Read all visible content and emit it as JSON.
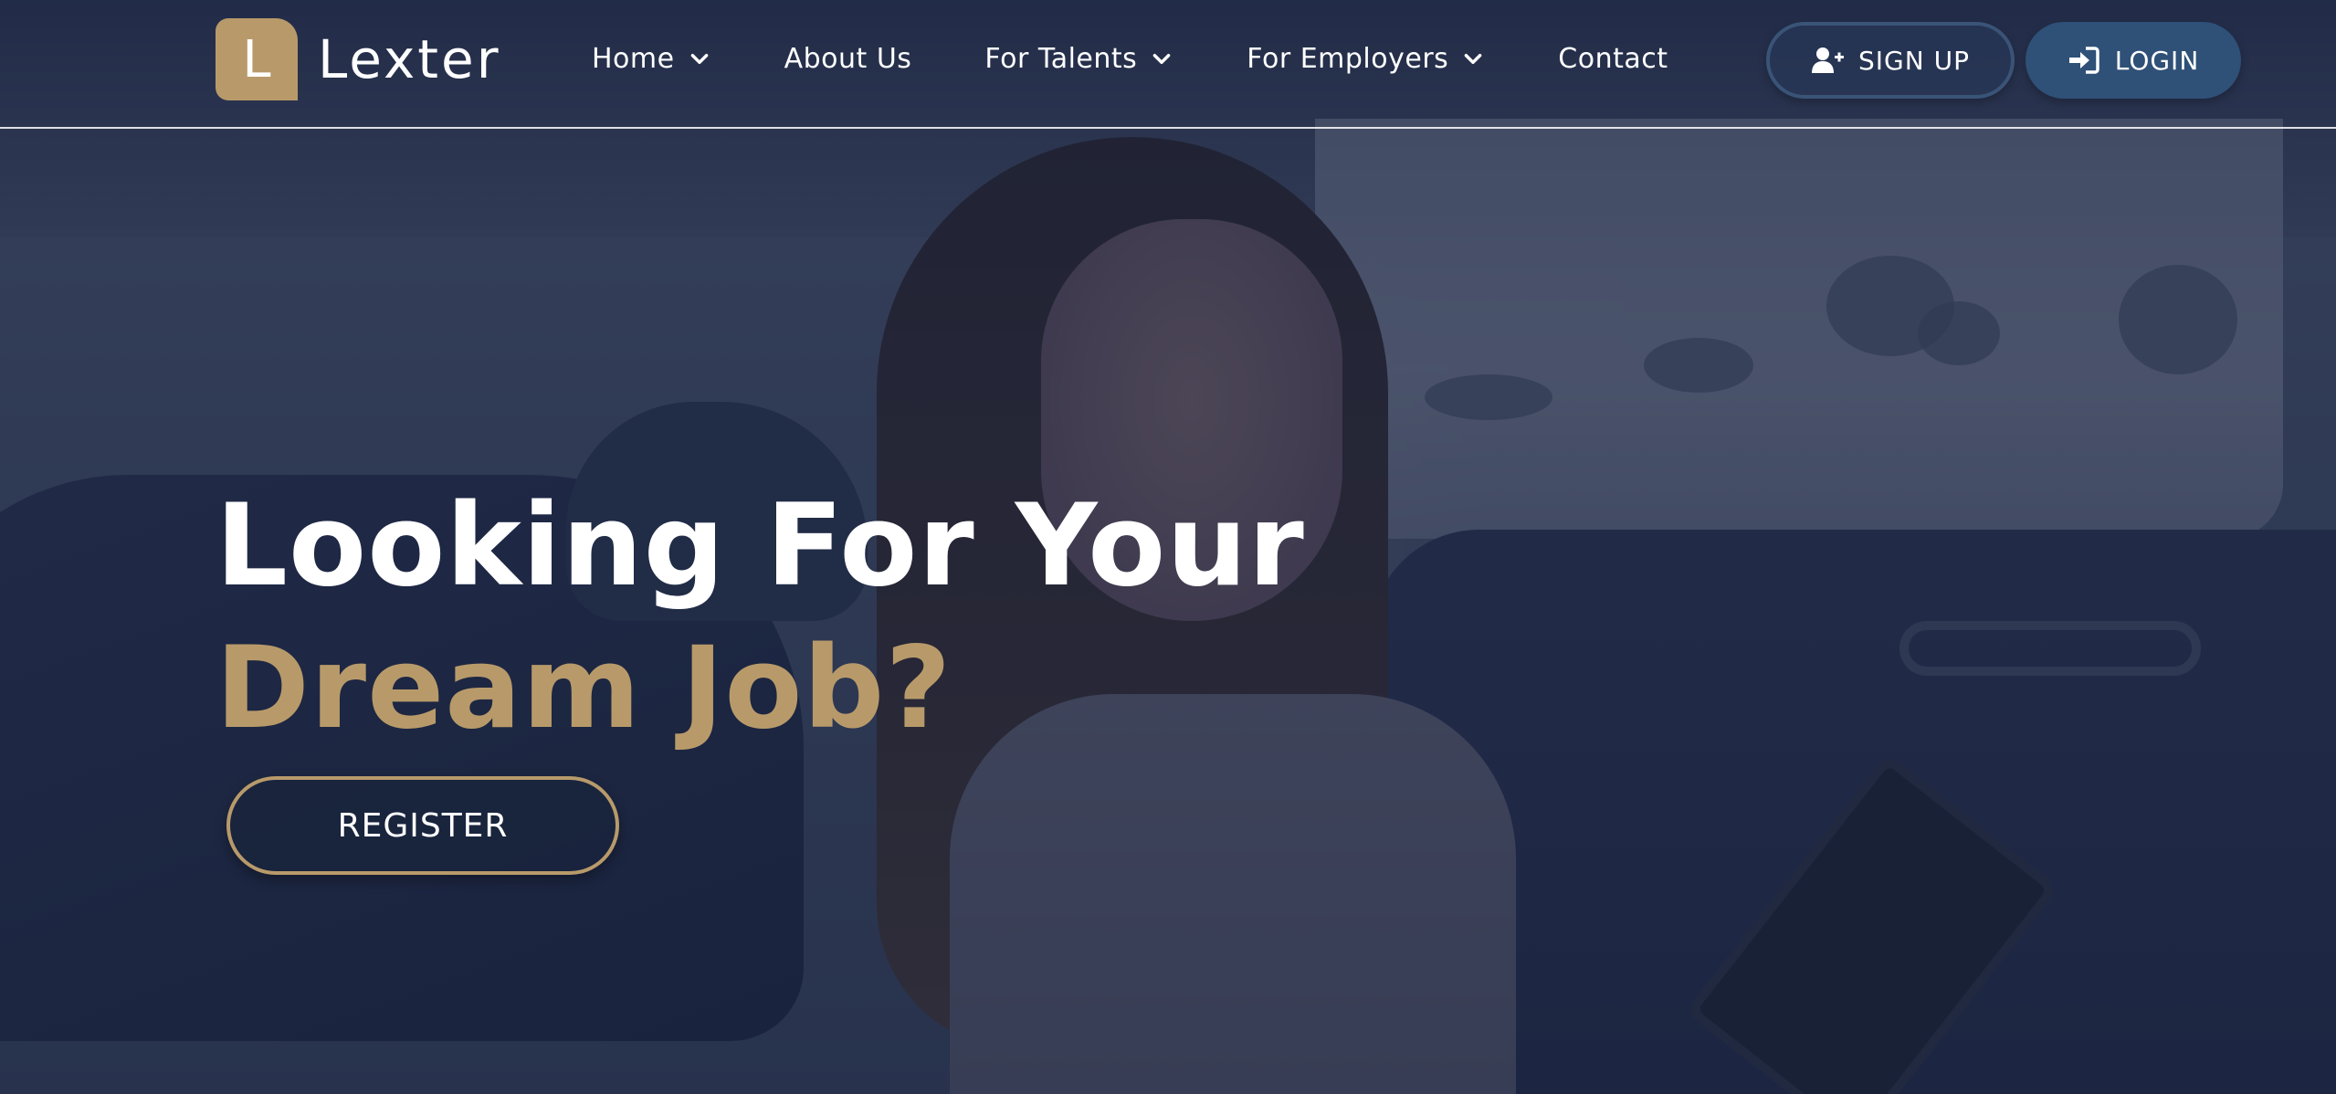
{
  "brand": {
    "logo_letter": "L",
    "name": "Lexter",
    "accent_color": "#b89a6a",
    "overlay_color": "#192542"
  },
  "nav": {
    "items": [
      {
        "label": "Home",
        "has_dropdown": true
      },
      {
        "label": "About Us",
        "has_dropdown": false
      },
      {
        "label": "For Talents",
        "has_dropdown": true
      },
      {
        "label": "For Employers",
        "has_dropdown": true
      },
      {
        "label": "Contact",
        "has_dropdown": false
      }
    ]
  },
  "auth": {
    "signup_label": "SIGN UP",
    "signup_icon": "user-plus-icon",
    "login_label": "LOGIN",
    "login_icon": "sign-in-icon",
    "login_color": "#2f5077"
  },
  "hero": {
    "headline_line1": "Looking For Your",
    "headline_line2": "Dream Job?",
    "cta_label": "REGISTER"
  }
}
